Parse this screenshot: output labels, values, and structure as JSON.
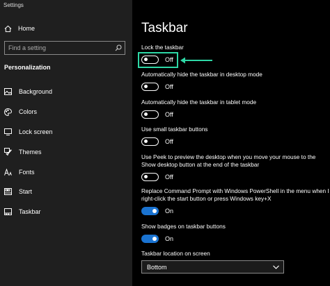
{
  "app": {
    "title": "Settings"
  },
  "sidebar": {
    "home_label": "Home",
    "search_placeholder": "Find a setting",
    "section_label": "Personalization",
    "items": [
      {
        "label": "Background",
        "icon": "image-icon"
      },
      {
        "label": "Colors",
        "icon": "palette-icon"
      },
      {
        "label": "Lock screen",
        "icon": "monitor-icon"
      },
      {
        "label": "Themes",
        "icon": "brush-icon"
      },
      {
        "label": "Fonts",
        "icon": "font-icon"
      },
      {
        "label": "Start",
        "icon": "start-icon"
      },
      {
        "label": "Taskbar",
        "icon": "taskbar-icon"
      }
    ]
  },
  "main": {
    "title": "Taskbar",
    "settings": [
      {
        "label": "Lock the taskbar",
        "state": "Off"
      },
      {
        "label": "Automatically hide the taskbar in desktop mode",
        "state": "Off"
      },
      {
        "label": "Automatically hide the taskbar in tablet mode",
        "state": "Off"
      },
      {
        "label": "Use small taskbar buttons",
        "state": "Off"
      },
      {
        "label": "Use Peek to preview the desktop when you move your mouse to the Show desktop button at the end of the taskbar",
        "state": "Off"
      },
      {
        "label": "Replace Command Prompt with Windows PowerShell in the menu when I right-click the start button or press Windows key+X",
        "state": "On"
      },
      {
        "label": "Show badges on taskbar buttons",
        "state": "On"
      }
    ],
    "location": {
      "label": "Taskbar location on screen",
      "value": "Bottom"
    }
  },
  "colors": {
    "accent": "#1a73d1",
    "highlight": "#2ed8a6",
    "sidebar_bg": "#1f1f1f",
    "main_bg": "#000000"
  }
}
